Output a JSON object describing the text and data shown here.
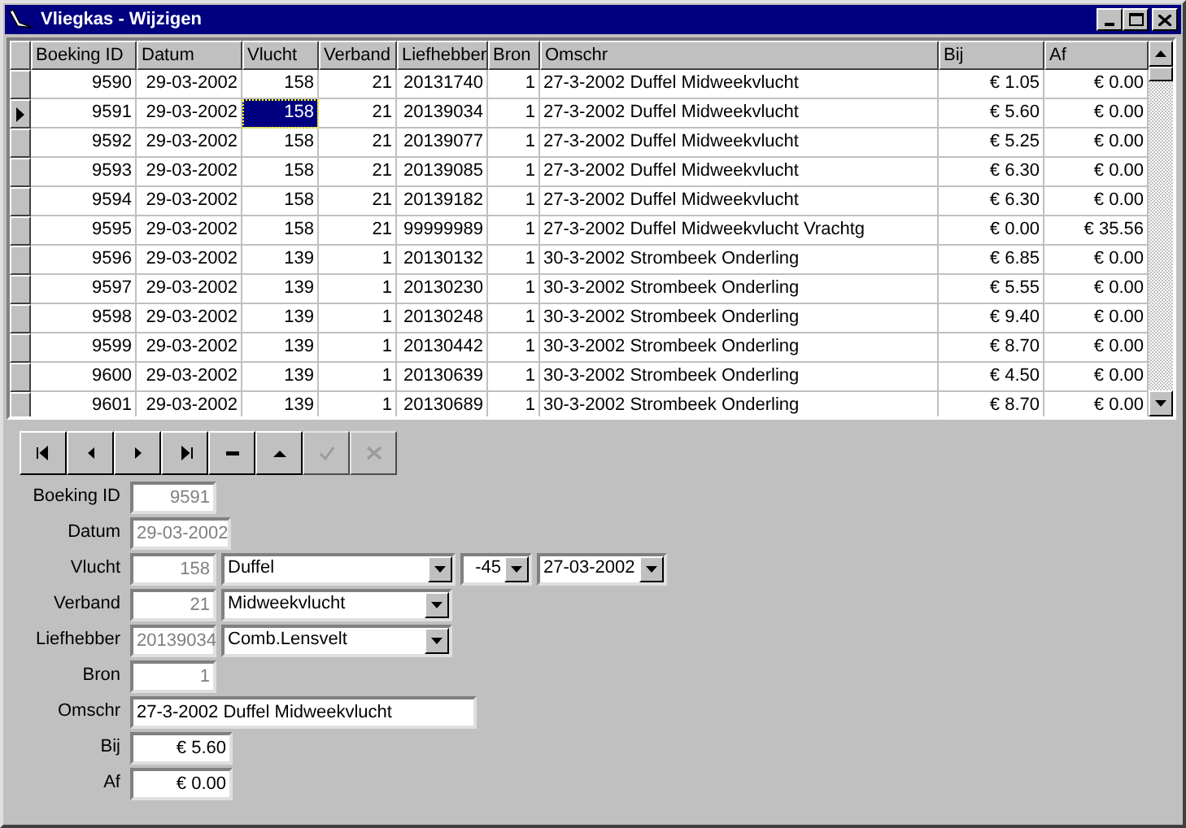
{
  "window": {
    "title": "Vliegkas - Wijzigen"
  },
  "grid": {
    "columns": [
      {
        "label": "Boeking ID",
        "focused": false
      },
      {
        "label": "Datum",
        "focused": false
      },
      {
        "label": "Vlucht",
        "focused": true
      },
      {
        "label": "Verband",
        "focused": false
      },
      {
        "label": "Liefhebber",
        "focused": false
      },
      {
        "label": "Bron",
        "focused": false
      },
      {
        "label": "Omschr",
        "focused": false
      },
      {
        "label": "Bij",
        "focused": false
      },
      {
        "label": "Af",
        "focused": false
      }
    ],
    "rows": [
      {
        "selected": false,
        "cells": [
          "9590",
          "29-03-2002",
          "158",
          "21",
          "20131740",
          "1",
          "27-3-2002  Duffel  Midweekvlucht",
          "€ 1.05",
          "€ 0.00"
        ]
      },
      {
        "selected": true,
        "cells": [
          "9591",
          "29-03-2002",
          "158",
          "21",
          "20139034",
          "1",
          "27-3-2002  Duffel  Midweekvlucht",
          "€ 5.60",
          "€ 0.00"
        ]
      },
      {
        "selected": false,
        "cells": [
          "9592",
          "29-03-2002",
          "158",
          "21",
          "20139077",
          "1",
          "27-3-2002  Duffel  Midweekvlucht",
          "€ 5.25",
          "€ 0.00"
        ]
      },
      {
        "selected": false,
        "cells": [
          "9593",
          "29-03-2002",
          "158",
          "21",
          "20139085",
          "1",
          "27-3-2002  Duffel  Midweekvlucht",
          "€ 6.30",
          "€ 0.00"
        ]
      },
      {
        "selected": false,
        "cells": [
          "9594",
          "29-03-2002",
          "158",
          "21",
          "20139182",
          "1",
          "27-3-2002  Duffel  Midweekvlucht",
          "€ 6.30",
          "€ 0.00"
        ]
      },
      {
        "selected": false,
        "cells": [
          "9595",
          "29-03-2002",
          "158",
          "21",
          "99999989",
          "1",
          "27-3-2002  Duffel  Midweekvlucht Vrachtg",
          "€ 0.00",
          "€ 35.56"
        ]
      },
      {
        "selected": false,
        "cells": [
          "9596",
          "29-03-2002",
          "139",
          "1",
          "20130132",
          "1",
          "30-3-2002  Strombeek  Onderling",
          "€ 6.85",
          "€ 0.00"
        ]
      },
      {
        "selected": false,
        "cells": [
          "9597",
          "29-03-2002",
          "139",
          "1",
          "20130230",
          "1",
          "30-3-2002  Strombeek  Onderling",
          "€ 5.55",
          "€ 0.00"
        ]
      },
      {
        "selected": false,
        "cells": [
          "9598",
          "29-03-2002",
          "139",
          "1",
          "20130248",
          "1",
          "30-3-2002  Strombeek  Onderling",
          "€ 9.40",
          "€ 0.00"
        ]
      },
      {
        "selected": false,
        "cells": [
          "9599",
          "29-03-2002",
          "139",
          "1",
          "20130442",
          "1",
          "30-3-2002  Strombeek  Onderling",
          "€ 8.70",
          "€ 0.00"
        ]
      },
      {
        "selected": false,
        "cells": [
          "9600",
          "29-03-2002",
          "139",
          "1",
          "20130639",
          "1",
          "30-3-2002  Strombeek  Onderling",
          "€ 4.50",
          "€ 0.00"
        ]
      },
      {
        "selected": false,
        "cells": [
          "9601",
          "29-03-2002",
          "139",
          "1",
          "20130689",
          "1",
          "30-3-2002  Strombeek  Onderling",
          "€ 8.70",
          "€ 0.00"
        ]
      }
    ]
  },
  "navigator": [
    {
      "kind": "first",
      "disabled": false
    },
    {
      "kind": "prior",
      "disabled": false
    },
    {
      "kind": "next",
      "disabled": false
    },
    {
      "kind": "last",
      "disabled": false
    },
    {
      "kind": "delete",
      "disabled": false
    },
    {
      "kind": "edit",
      "disabled": false
    },
    {
      "kind": "post",
      "disabled": true
    },
    {
      "kind": "cancel",
      "disabled": true
    }
  ],
  "form": [
    {
      "label": "Boeking ID",
      "value": "9591",
      "disabled": true
    },
    {
      "label": "Datum",
      "value": "29-03-2002",
      "disabled": true
    },
    {
      "label": "Vlucht",
      "value": "158",
      "disabled": true,
      "combos": [
        "Duffel",
        "-45",
        "27-03-2002"
      ]
    },
    {
      "label": "Verband",
      "value": "21",
      "disabled": true,
      "combos": [
        "Midweekvlucht"
      ]
    },
    {
      "label": "Liefhebber",
      "value": "20139034",
      "disabled": true,
      "combos": [
        "Comb.Lensvelt"
      ]
    },
    {
      "label": "Bron",
      "value": "1",
      "disabled": true
    },
    {
      "label": "Omschr",
      "value": "27-3-2002  Duffel  Midweekvlucht",
      "disabled": false
    },
    {
      "label": "Bij",
      "value": "€ 5.60",
      "disabled": false
    },
    {
      "label": "Af",
      "value": "€ 0.00",
      "disabled": false
    }
  ]
}
